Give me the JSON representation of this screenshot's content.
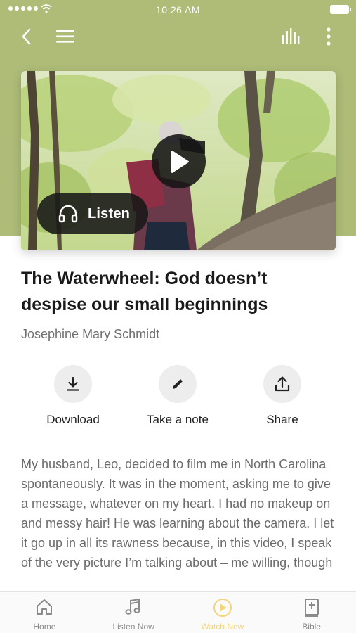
{
  "status_bar": {
    "time": "10:26 AM"
  },
  "nav": {
    "back_icon": "chevron-left-icon",
    "menu_icon": "hamburger-menu-icon",
    "audio_icon": "audio-bars-icon",
    "more_icon": "more-vertical-icon"
  },
  "hero": {
    "play_icon": "play-icon",
    "listen_label": "Listen",
    "listen_icon": "headphones-icon"
  },
  "article": {
    "title": "The Waterwheel: God doesn’t despise our small beginnings",
    "author": "Josephine Mary Schmidt",
    "body": "My husband, Leo, decided to film me in North Carolina spontaneously. It was in the moment, asking me to give a message, whatever on my heart. I had no makeup on and messy hair! He was learning about the camera. I let it go up in all its rawness because, in this video, I speak of the very picture I’m talking about – me willing, though"
  },
  "actions": [
    {
      "label": "Download",
      "icon": "download-icon"
    },
    {
      "label": "Take a note",
      "icon": "pencil-icon"
    },
    {
      "label": "Share",
      "icon": "share-icon"
    }
  ],
  "tabs": [
    {
      "label": "Home",
      "icon": "home-icon",
      "active": false
    },
    {
      "label": "Listen Now",
      "icon": "music-note-icon",
      "active": false
    },
    {
      "label": "Watch Now",
      "icon": "play-circle-icon",
      "active": true
    },
    {
      "label": "Bible",
      "icon": "bible-icon",
      "active": false
    }
  ],
  "colors": {
    "header_band": "#aebc78",
    "active_tab": "#f3d67a",
    "body_text": "#6b6b6b",
    "action_circle": "#ededed"
  }
}
